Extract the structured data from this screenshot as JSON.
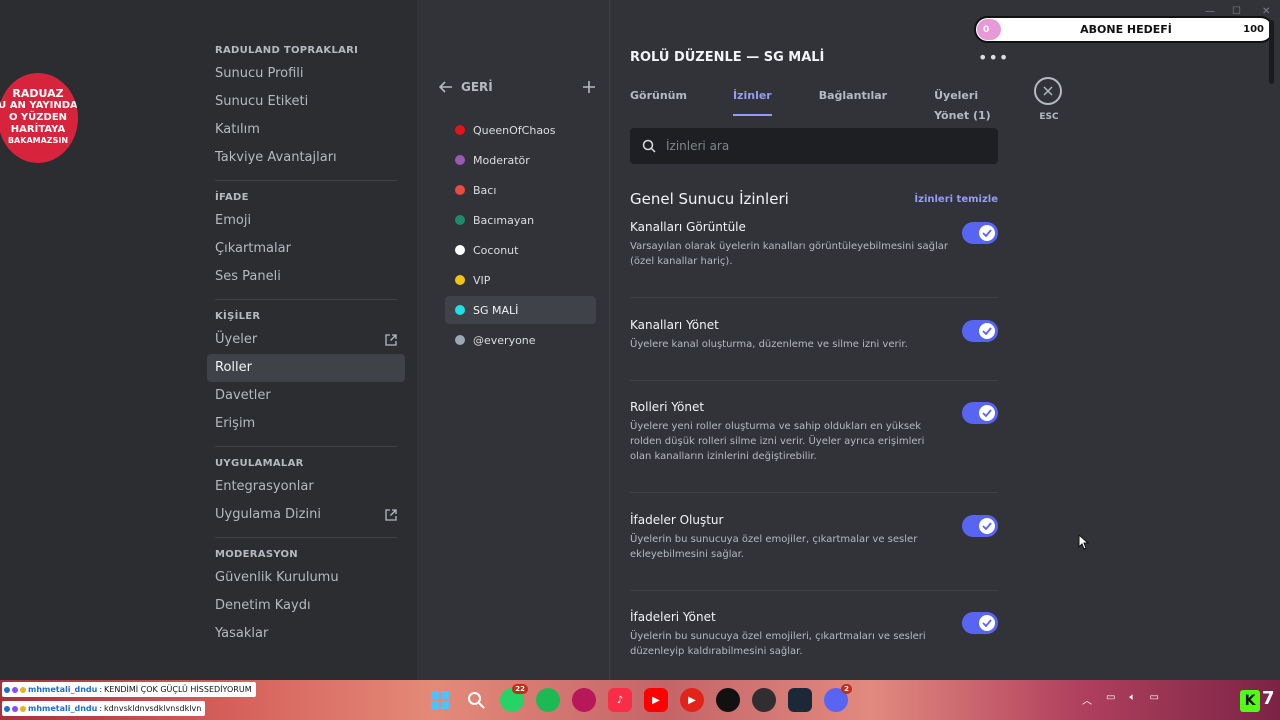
{
  "sidebar": {
    "sections": [
      {
        "title": "RADULAND TOPRAKLARI",
        "items": [
          "Sunucu Profili",
          "Sunucu Etiketi",
          "Katılım",
          "Takviye Avantajları"
        ]
      },
      {
        "title": "İFADE",
        "items": [
          "Emoji",
          "Çıkartmalar",
          "Ses Paneli"
        ]
      },
      {
        "title": "KİŞİLER",
        "items": [
          "Üyeler",
          "Roller",
          "Davetler",
          "Erişim"
        ]
      },
      {
        "title": "UYGULAMALAR",
        "items": [
          "Entegrasyonlar",
          "Uygulama Dizini"
        ]
      },
      {
        "title": "MODERASYON",
        "items": [
          "Güvenlik Kurulumu",
          "Denetim Kaydı",
          "Yasaklar"
        ]
      }
    ],
    "active_item": "Roller"
  },
  "badge": {
    "line1": "RADUAZ",
    "line2": "U AN YAYINDA",
    "line3": "O YÜZDEN",
    "line4": "HARİTAYA",
    "line5": "BAKAMAZSIN"
  },
  "roles_panel": {
    "back_label": "GERİ",
    "roles": [
      {
        "name": "QueenOfChaos",
        "color": "#e0141d"
      },
      {
        "name": "Moderatör",
        "color": "#9b59b6"
      },
      {
        "name": "Bacı",
        "color": "#e74c3c"
      },
      {
        "name": "Bacımayan",
        "color": "#1f8b6b"
      },
      {
        "name": "Coconut",
        "color": "#ffffff"
      },
      {
        "name": "VIP",
        "color": "#f1c40f"
      },
      {
        "name": "SG MALİ",
        "color": "#1ee0e8"
      },
      {
        "name": "@everyone",
        "color": "#99aab5"
      }
    ],
    "active_role": "SG MALİ"
  },
  "main": {
    "title": "ROLÜ DÜZENLE — SG MALİ",
    "tabs": [
      "Görünüm",
      "İzinler",
      "Bağlantılar",
      "Üyeleri Yönet (1)"
    ],
    "active_tab": "İzinler",
    "search_placeholder": "İzinleri ara",
    "section_title": "Genel Sunucu İzinleri",
    "clear_label": "İzinleri temizle",
    "permissions": [
      {
        "name": "Kanalları Görüntüle",
        "desc": "Varsayılan olarak üyelerin kanalları görüntüleyebilmesini sağlar (özel kanallar hariç).",
        "enabled": true
      },
      {
        "name": "Kanalları Yönet",
        "desc": "Üyelere kanal oluşturma, düzenleme ve silme izni verir.",
        "enabled": true
      },
      {
        "name": "Rolleri Yönet",
        "desc": "Üyelere yeni roller oluşturma ve sahip oldukları en yüksek rolden düşük rolleri silme izni verir. Üyeler ayrıca erişimleri olan kanalların izinlerini değiştirebilir.",
        "enabled": true
      },
      {
        "name": "İfadeler Oluştur",
        "desc": "Üyelerin bu sunucuya özel emojiler, çıkartmalar ve sesler ekleyebilmesini sağlar.",
        "enabled": true
      },
      {
        "name": "İfadeleri Yönet",
        "desc": "Üyelerin bu sunucuya özel emojileri, çıkartmaları ve sesleri düzenleyip kaldırabilmesini sağlar.",
        "enabled": true
      }
    ]
  },
  "esc_label": "ESC",
  "goal": {
    "label": "ABONE HEDEFİ",
    "current": "0",
    "max": "100"
  },
  "chat": [
    {
      "user": "mhmetali_dndu",
      "message": "KENDİMİ ÇOK GÜÇLÜ HİSSEDİYORUM"
    },
    {
      "user": "mhmetali_dndu",
      "message": "kdnvskldnvsdklvnsdklvn"
    }
  ],
  "taskbar": {
    "badges": {
      "whatsapp": "22",
      "discord": "2"
    },
    "kick_label": "K",
    "count": "7"
  },
  "colors": {
    "accent": "#5865f2",
    "link": "#949cf7",
    "sidebar_bg": "#2b2d31",
    "content_bg": "#313338"
  }
}
